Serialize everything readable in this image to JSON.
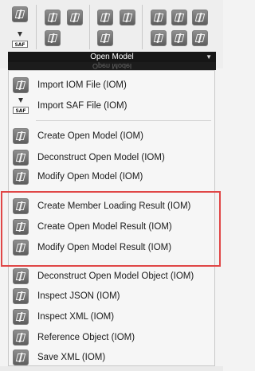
{
  "ribbon": {
    "panel_title": "Open Model",
    "ghost_title": "Open Model",
    "expand_icon": "arrow-down-icon",
    "groups": [
      {
        "icons": [
          "iom-icon",
          "saf-icon"
        ],
        "saf_label": "SAF"
      },
      {
        "icons": [
          "iom-icon",
          "iom-icon",
          "iom-icon"
        ]
      },
      {
        "icons": [
          "iom-icon",
          "iom-icon",
          "iom-icon"
        ]
      },
      {
        "icons": [
          "iom-icon",
          "iom-icon",
          "iom-icon",
          "iom-icon",
          "iom-icon",
          "iom-icon"
        ]
      }
    ]
  },
  "menu": {
    "items": [
      {
        "label": "Import IOM File (IOM)",
        "icon": "iom-icon"
      },
      {
        "label": "Import SAF File (IOM)",
        "icon": "saf-icon",
        "icon_text": "SAF"
      },
      {
        "label": "Create Open Model (IOM)",
        "icon": "iom-icon"
      },
      {
        "label": "Deconstruct Open Model (IOM)",
        "icon": "iom-icon"
      },
      {
        "label": "Modify Open Model (IOM)",
        "icon": "iom-icon"
      },
      {
        "label": "Create Member Loading Result (IOM)",
        "icon": "iom-icon"
      },
      {
        "label": "Create Open Model Result (IOM)",
        "icon": "iom-icon"
      },
      {
        "label": "Modify Open Model Result (IOM)",
        "icon": "iom-icon"
      },
      {
        "label": "Deconstruct Open Model Object (IOM)",
        "icon": "iom-icon"
      },
      {
        "label": "Inspect JSON (IOM)",
        "icon": "iom-icon"
      },
      {
        "label": "Inspect XML (IOM)",
        "icon": "iom-icon"
      },
      {
        "label": "Reference Object (IOM)",
        "icon": "iom-icon"
      },
      {
        "label": "Save XML (IOM)",
        "icon": "iom-icon"
      }
    ],
    "highlight_color": "#e04646"
  }
}
